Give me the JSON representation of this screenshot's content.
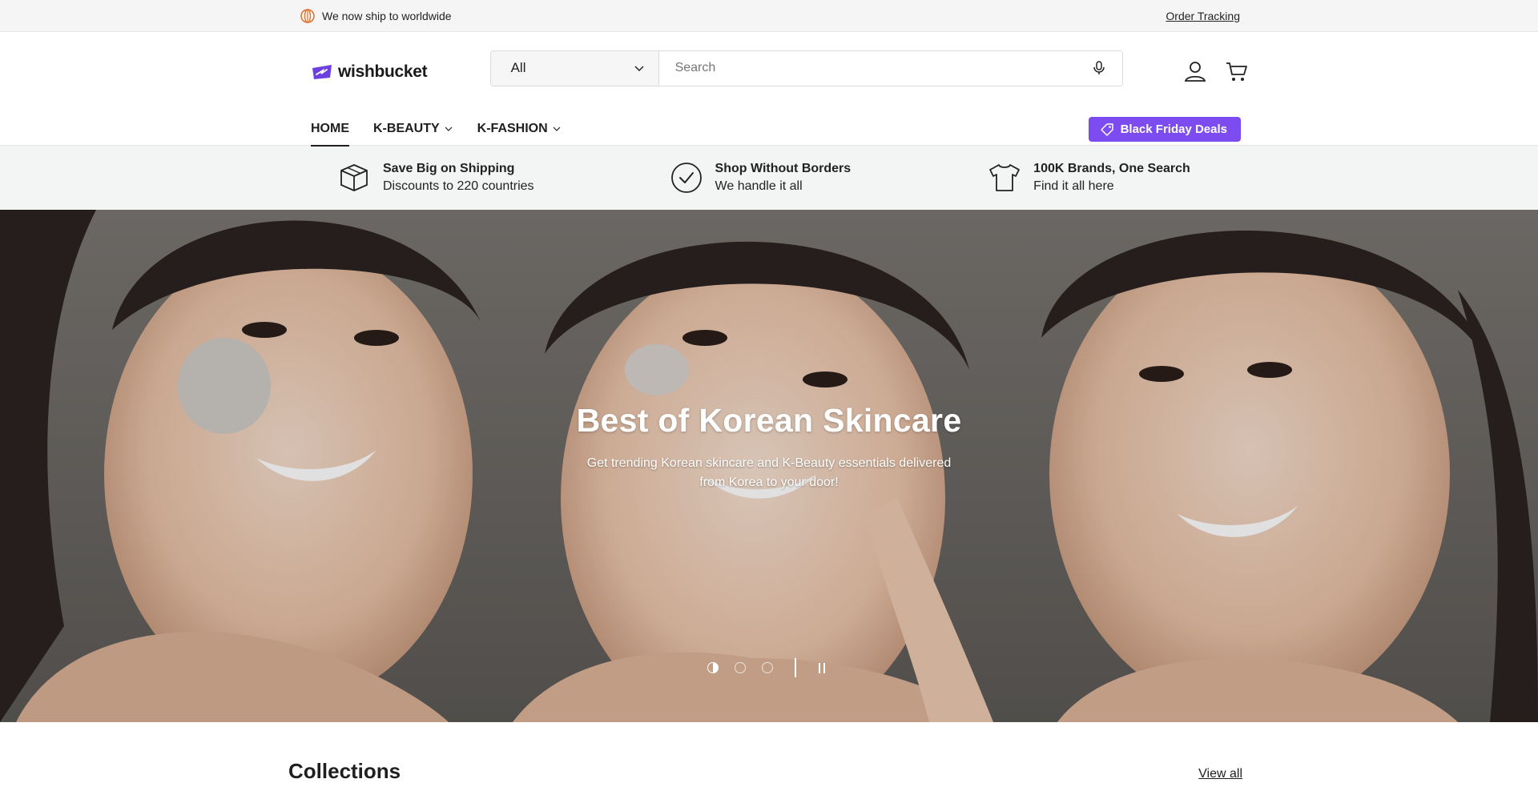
{
  "announcement": {
    "text": "We now ship to worldwide",
    "order_tracking": "Order Tracking"
  },
  "header": {
    "logo_text": "wishbucket",
    "search": {
      "category": "All",
      "placeholder": "Search"
    },
    "icons": [
      "globe-icon",
      "mic-icon",
      "account-icon",
      "cart-icon"
    ]
  },
  "nav": {
    "items": [
      {
        "label": "HOME",
        "active": true
      },
      {
        "label": "K-BEAUTY",
        "dropdown": true
      },
      {
        "label": "K-FASHION",
        "dropdown": true
      }
    ],
    "deal_button": "Black Friday Deals"
  },
  "benefits": [
    {
      "title": "Save Big on Shipping",
      "subtitle": "Discounts to 220 countries",
      "icon": "box-icon"
    },
    {
      "title": "Shop Without Borders",
      "subtitle": "We handle it all",
      "icon": "check-circle-icon"
    },
    {
      "title": "100K Brands, One Search",
      "subtitle": "Find it all here",
      "icon": "tshirt-icon"
    }
  ],
  "hero": {
    "title": "Best of Korean Skincare",
    "subtitle": "Get trending Korean skincare and K-Beauty essentials delivered from Korea to your door!",
    "slide_count": 3,
    "active_slide": 1
  },
  "collections": {
    "title": "Collections",
    "view_all": "View all"
  },
  "colors": {
    "accent": "#7c4cf0",
    "text": "#1f1f21",
    "strip_bg": "#f3f4f4",
    "announce_bg": "#f5f5f5",
    "globe": "#e0752b"
  }
}
